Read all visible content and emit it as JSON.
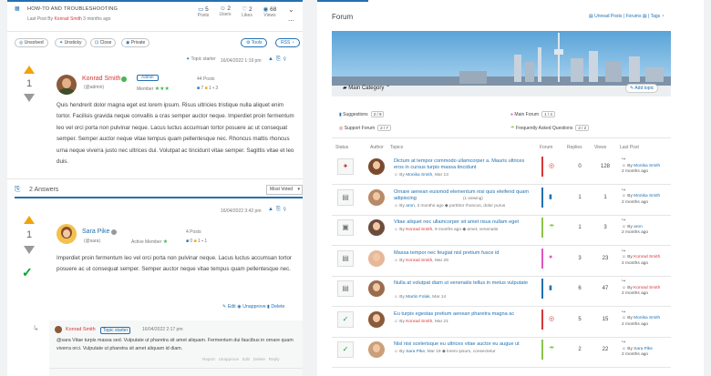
{
  "topic": {
    "title": "HOW-TO AND TROUBLESHOOTING",
    "last_post": "Last Post By",
    "last_post_user": "Konrad Smith",
    "last_post_time": "3 months ago",
    "stats": [
      {
        "v": "5",
        "l": "Posts"
      },
      {
        "v": "2",
        "l": "Users"
      },
      {
        "v": "2",
        "l": "Likes"
      },
      {
        "v": "68",
        "l": "Views"
      }
    ],
    "tags": [
      "Unsolved",
      "Unsticky",
      "Close",
      "Private"
    ],
    "tools": "Tools",
    "rss": "RSS"
  },
  "post1": {
    "topic_starter": "Topic starter",
    "date": "16/04/2022 1:19 pm",
    "votes": "1",
    "name": "Konrad Smith",
    "handle": "(@admin)",
    "role_badge": "Admin",
    "rank": "Member",
    "posts_label": "44 Posts",
    "c1": "7",
    "c2": "1",
    "c3": "3",
    "text": "Quis hendrerit dolor magna eget est lorem ipsum. Risus ultricies tristique nulla aliquet enim tortor. Facilisis gravida neque convallis a cras semper auctor neque. Imperdiet proin fermentum leo vel orci porta non pulvinar neque. Lacus luctus accumsan tortor posuere ac ut consequat semper. Semper auctor neque vitae tempus quam pellentesque nec. Rhoncus mattis rhoncus urna neque viverra justo nec ultrices dui. Volutpat ac tincidunt vitae semper. Sagittis vitae et leo duis."
  },
  "answers": {
    "label": "2 Answers",
    "sort": "Most Voted"
  },
  "post2": {
    "date": "16/04/2022 3:42 pm",
    "votes": "1",
    "name": "Sara Pike",
    "handle": "(@sara)",
    "rank": "Active Member",
    "posts_label": "4 Posts",
    "c1": "0",
    "c2": "1",
    "c3": "1",
    "text": "Imperdiet proin fermentum leo vel orci porta non pulvinar neque. Lacus luctus accumsan tortor posuere ac ut consequat semper. Semper auctor neque vitae tempus quam pellentesque nec.",
    "actions": [
      "Edit",
      "Unapprove",
      "Delete"
    ]
  },
  "reply": {
    "name": "Konrad Smith",
    "starter": "Topic starter",
    "date": "16/04/2022 2:17 pm",
    "text": "@sara Vitae turpis massa sed. Vulputate ut pharetra sit amet aliquam. Fermentum dui faucibus in ornare quam viverra orci. Vulputate ut pharetra sit amet aliquam id diam.",
    "actions": "Report   Unapprove   Edit   Delete   Reply"
  },
  "forum": {
    "title": "Forum",
    "links": [
      "Unread Posts",
      "Forums",
      "Tags"
    ],
    "category": "Main Category",
    "add_topic": "Add topic",
    "subs": [
      {
        "name": "Suggestions",
        "count": "2 / 9"
      },
      {
        "name": "Main Forum",
        "count": "1 / 4"
      },
      {
        "name": "Support Forum",
        "count": "2 / 7"
      },
      {
        "name": "Frequently Asked Questions",
        "count": "2 / 2"
      }
    ],
    "cols": [
      "Status",
      "Author",
      "Topics",
      "Forum",
      "Replies",
      "Views",
      "Last Post"
    ],
    "rows": [
      {
        "title": "Dictum at tempor commodo ullamcorper a. Mauris ultrices eros in cursus turpis massa tincidunt",
        "by": "By",
        "user": "Monika Smith",
        "time": "Mar 13",
        "extra": "",
        "replies": "0",
        "views": "128",
        "lp_user": "Monika Smith",
        "lp_time": "2 months ago",
        "bar": "#d63638",
        "status": "pin"
      },
      {
        "title": "Ornare aenean euismod elementum nisi quis eleifend quam adipiscing",
        "sub": "(1 viewing)",
        "by": "By",
        "user": "aron",
        "time": "3 months ago",
        "extra": "porttitor rhoncus, dolor purus",
        "replies": "1",
        "views": "1",
        "lp_user": "Monika Smith",
        "lp_time": "2 months ago",
        "bar": "#2271b1",
        "status": "doc"
      },
      {
        "title": "Vitae aliquet nec ullamcorper sit amet risus nullam eget",
        "by": "By",
        "user": "Konrad Smith",
        "time": "9 months ago",
        "extra": "amet, venenatis",
        "replies": "1",
        "views": "3",
        "lp_user": "aron",
        "lp_time": "2 months ago",
        "bar": "#8bc34a",
        "status": "lock"
      },
      {
        "title": "Massa tempor nec feugiat nisl pretium fusce id",
        "by": "By",
        "user": "Konrad Smith",
        "time": "Mar 28",
        "extra": "",
        "replies": "3",
        "views": "23",
        "lp_user": "Konrad Smith",
        "lp_time": "2 months ago",
        "bar": "#e056c0",
        "status": "doc"
      },
      {
        "title": "Nulla at volutpat diam ut venenatis tellus in metus vulputate",
        "by": "By",
        "user": "Martin Folak",
        "time": "Mar 14",
        "extra": "",
        "replies": "6",
        "views": "47",
        "lp_user": "Konrad Smith",
        "lp_time": "2 months ago",
        "bar": "#2271b1",
        "status": "doc"
      },
      {
        "title": "Eu turpis egestas pretium aenean pharetra magna ac",
        "by": "By",
        "user": "Konrad Smith",
        "time": "Mar 21",
        "extra": "",
        "replies": "5",
        "views": "15",
        "lp_user": "Monika Smith",
        "lp_time": "2 months ago",
        "bar": "#d63638",
        "status": "check"
      },
      {
        "title": "Nisl nisi scelerisque eu ultrices vitae auctor eu augue ut",
        "by": "By",
        "user": "Sara Pike",
        "time": "Mar 19",
        "extra": "lorem ipsum, consectetur",
        "replies": "2",
        "views": "22",
        "lp_user": "Sara Pike",
        "lp_time": "2 months ago",
        "bar": "#8bc34a",
        "status": "check"
      }
    ]
  },
  "colors": {
    "accent": "#2271b1",
    "konrad": "#d63638",
    "vote": "#f0a30a",
    "check": "#00a32a"
  }
}
